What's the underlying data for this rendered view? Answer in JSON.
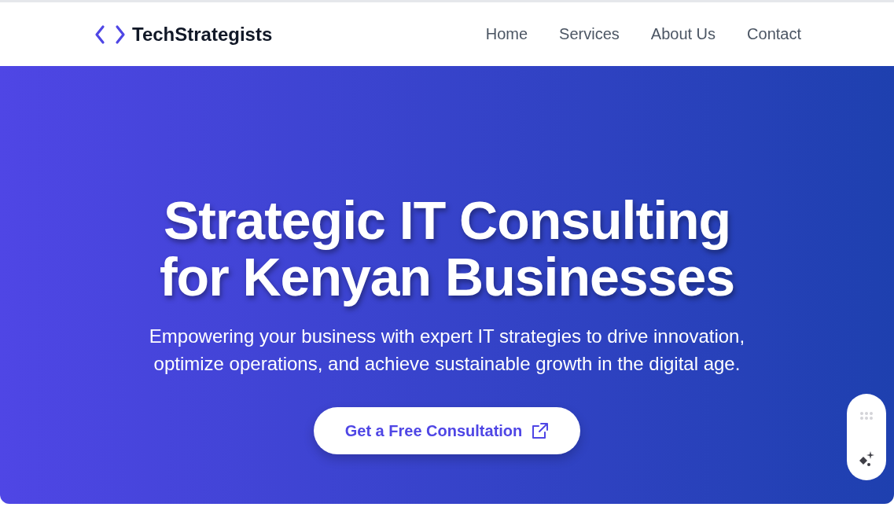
{
  "brand": {
    "name": "TechStrategists"
  },
  "nav": [
    {
      "label": "Home"
    },
    {
      "label": "Services"
    },
    {
      "label": "About Us"
    },
    {
      "label": "Contact"
    }
  ],
  "hero": {
    "title_lines": [
      "Strategic IT Consulting",
      "for Kenyan Businesses"
    ],
    "subtitle_lines": [
      "Empowering your business with expert IT strategies to drive innovation,",
      "optimize operations, and achieve sustainable growth in the digital age."
    ],
    "cta": "Get a Free Consultation"
  }
}
